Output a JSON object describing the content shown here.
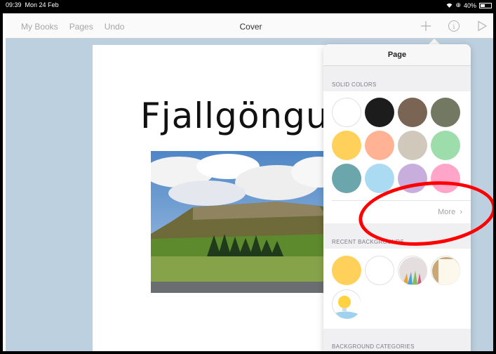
{
  "status_bar": {
    "time": "09:39",
    "date": "Mon 24 Feb",
    "battery": "40%"
  },
  "nav": {
    "my_books": "My Books",
    "pages": "Pages",
    "undo": "Undo",
    "title": "Cover",
    "add_icon": "plus-icon",
    "info_icon": "info-icon",
    "play_icon": "play-icon"
  },
  "page": {
    "title": "Fjallgöngu"
  },
  "popover": {
    "title": "Page",
    "solid_colors_label": "SOLID COLORS",
    "solid_colors": [
      "#ffffff",
      "#1c1c1c",
      "#7a6453",
      "#737862",
      "#ffd05a",
      "#ffb394",
      "#cfc8bb",
      "#9ddcab",
      "#6aa6ab",
      "#abdaf3",
      "#c8aedd",
      "#ffa5ca"
    ],
    "more_label": "More",
    "recent_label": "RECENT BACKGROUNDS",
    "recent": [
      "#ffd05a",
      "#ffffff",
      "pencils-image",
      "paper-image",
      "bulb-image"
    ],
    "categories_label": "BACKGROUND CATEGORIES"
  },
  "colors": {
    "canvas": "#bdd0e0",
    "annotation": "#ff0000",
    "accent": "#a4a4a8"
  }
}
